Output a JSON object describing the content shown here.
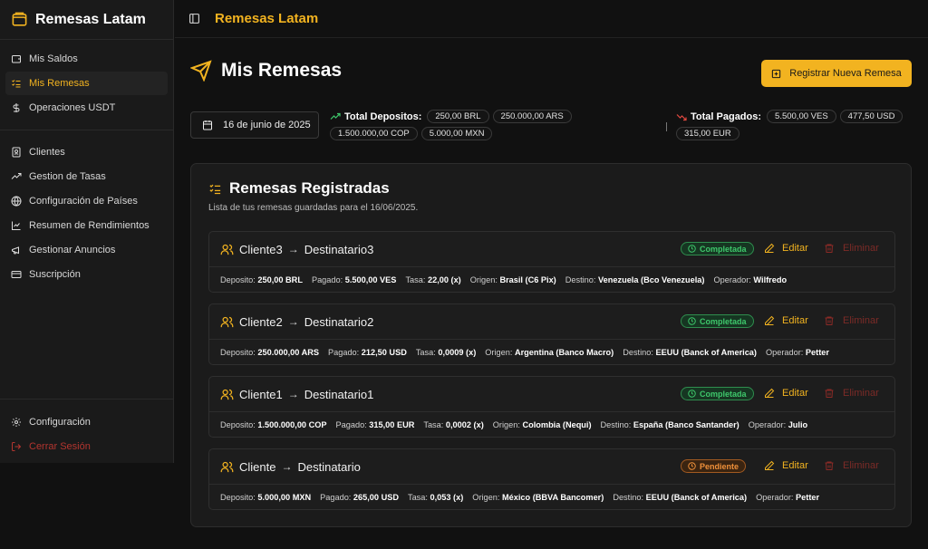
{
  "app": {
    "brand": "Remesas Latam",
    "title": "Remesas Latam"
  },
  "colors": {
    "accent": "#f2b320",
    "success": "#3ec76b",
    "pending": "#f0913a",
    "danger": "#b3352f"
  },
  "sidebar": {
    "items": [
      {
        "label": "Mis Saldos",
        "icon": "wallet-icon"
      },
      {
        "label": "Mis Remesas",
        "icon": "list-check-icon",
        "active": true
      },
      {
        "label": "Operaciones USDT",
        "icon": "dollar-icon"
      },
      {
        "label": "Clientes",
        "icon": "contact-book-icon"
      },
      {
        "label": "Gestion de Tasas",
        "icon": "trending-up-icon"
      },
      {
        "label": "Configuración de Países",
        "icon": "globe-icon"
      },
      {
        "label": "Resumen de Rendimientos",
        "icon": "line-chart-icon"
      },
      {
        "label": "Gestionar Anuncios",
        "icon": "megaphone-icon"
      },
      {
        "label": "Suscripción",
        "icon": "credit-card-icon"
      }
    ],
    "bottom": [
      {
        "label": "Configuración",
        "icon": "gear-icon"
      },
      {
        "label": "Cerrar Sesión",
        "icon": "logout-icon"
      }
    ]
  },
  "page": {
    "title": "Mis Remesas",
    "register_button": "Registrar Nueva Remesa",
    "date": "16 de junio de 2025"
  },
  "totals": {
    "deposits_label": "Total Depositos:",
    "deposits": [
      "250,00 BRL",
      "250.000,00 ARS",
      "1.500.000,00 COP",
      "5.000,00 MXN"
    ],
    "paid_label": "Total Pagados:",
    "paid": [
      "5.500,00 VES",
      "477,50 USD",
      "315,00 EUR"
    ]
  },
  "card": {
    "title": "Remesas Registradas",
    "subtitle": "Lista de tus remesas guardadas para el 16/06/2025."
  },
  "labels": {
    "deposito": "Deposito:",
    "pagado": "Pagado:",
    "tasa": "Tasa:",
    "origen": "Origen:",
    "destino": "Destino:",
    "operador": "Operador:",
    "edit": "Editar",
    "delete": "Eliminar"
  },
  "remesas": [
    {
      "cliente": "Cliente3",
      "destinatario": "Destinatario3",
      "status": "Completada",
      "status_kind": "ok",
      "deposito": "250,00 BRL",
      "pagado": "5.500,00 VES",
      "tasa": "22,00 (x)",
      "origen": "Brasil (C6 Pix)",
      "destino": "Venezuela (Bco Venezuela)",
      "operador": "Wilfredo"
    },
    {
      "cliente": "Cliente2",
      "destinatario": "Destinatario2",
      "status": "Completada",
      "status_kind": "ok",
      "deposito": "250.000,00 ARS",
      "pagado": "212,50 USD",
      "tasa": "0,0009 (x)",
      "origen": "Argentina (Banco Macro)",
      "destino": "EEUU (Banck of America)",
      "operador": "Petter"
    },
    {
      "cliente": "Cliente1",
      "destinatario": "Destinatario1",
      "status": "Completada",
      "status_kind": "ok",
      "deposito": "1.500.000,00 COP",
      "pagado": "315,00 EUR",
      "tasa": "0,0002 (x)",
      "origen": "Colombia (Nequi)",
      "destino": "España (Banco Santander)",
      "operador": "Julio"
    },
    {
      "cliente": "Cliente",
      "destinatario": "Destinatario",
      "status": "Pendiente",
      "status_kind": "pend",
      "deposito": "5.000,00 MXN",
      "pagado": "265,00 USD",
      "tasa": "0,053 (x)",
      "origen": "México (BBVA Bancomer)",
      "destino": "EEUU (Banck of America)",
      "operador": "Petter"
    }
  ]
}
